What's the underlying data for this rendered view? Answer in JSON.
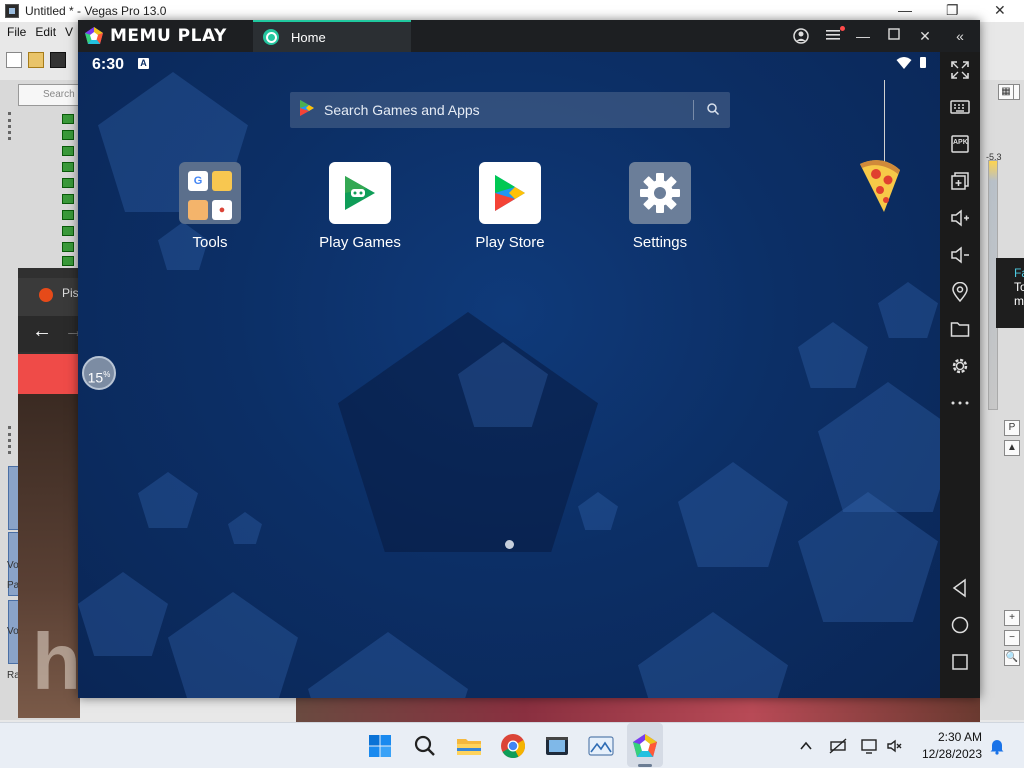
{
  "vegas": {
    "title": "Untitled * - Vegas Pro 13.0",
    "menu": [
      "File",
      "Edit",
      "V"
    ],
    "search_placeholder": "Search",
    "side_labels": [
      "Vo",
      "Pa",
      "Vo",
      "Ra"
    ],
    "meter_value": "-5.3",
    "tooltip": {
      "line1": "Fa",
      "line2": "To",
      "line3": "m"
    }
  },
  "background_browser": {
    "tab_label": "Pis",
    "video_text": "h"
  },
  "memu": {
    "logo_text": "MEMU PLAY",
    "tab_label": "Home",
    "status": {
      "time": "6:30",
      "a_badge": "A"
    },
    "search": {
      "placeholder": "Search Games and Apps"
    },
    "apps": [
      {
        "label": "Tools"
      },
      {
        "label": "Play Games"
      },
      {
        "label": "Play Store"
      },
      {
        "label": "Settings"
      }
    ],
    "loader": {
      "value": "15",
      "unit": "%"
    },
    "side_icons": [
      "fullscreen-icon",
      "keyboard-icon",
      "apk-icon",
      "multi-instance-icon",
      "volume-up-icon",
      "volume-down-icon",
      "location-icon",
      "folder-icon",
      "settings-icon",
      "more-icon",
      "back-icon",
      "home-icon",
      "recents-icon"
    ],
    "apk_label": "APK",
    "colors": {
      "accent": "#20c9a0",
      "screen_bg": "#0c2f66",
      "chrome": "#1d1f22"
    }
  },
  "taskbar": {
    "icons": [
      "windows-start-icon",
      "search-icon",
      "file-explorer-icon",
      "chrome-icon",
      "vegas-icon",
      "photos-icon",
      "memu-icon"
    ],
    "time": "2:30 AM",
    "date": "12/28/2023"
  }
}
